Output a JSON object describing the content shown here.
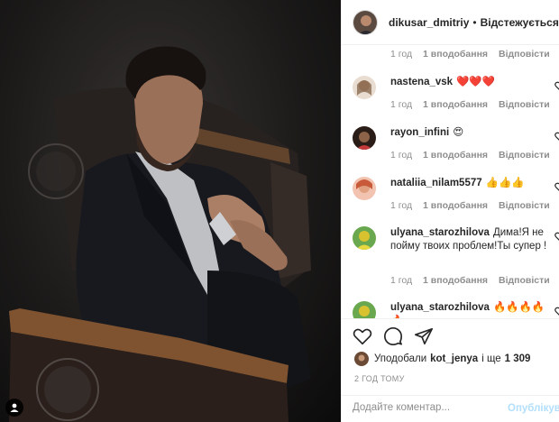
{
  "post_author": {
    "username": "dikusar_dmitriy",
    "separator": "•",
    "follow_label": "Відстежується"
  },
  "comments": [
    {
      "username": "",
      "text": "",
      "time": "1 год",
      "likes": "1 вподобання",
      "reply": "Відповісти",
      "avatar_color": "#9a7a60"
    },
    {
      "username": "nastena_vsk",
      "text": "❤️❤️❤️",
      "time": "1 год",
      "likes": "1 вподобання",
      "reply": "Відповісти",
      "avatar_color": "#c9a48a"
    },
    {
      "username": "rayon_infini",
      "text": "😍",
      "time": "1 год",
      "likes": "1 вподобання",
      "reply": "Відповісти",
      "avatar_color": "#3a2a22"
    },
    {
      "username": "nataliia_nilam5577",
      "text": "👍👍👍",
      "time": "1 год",
      "likes": "1 вподобання",
      "reply": "Відповісти",
      "avatar_color": "#d8826a"
    },
    {
      "username": "ulyana_starozhilova",
      "text": "Дима!Я не пойму твоих проблем!Ты супер !",
      "time": "1 год",
      "likes": "1 вподобання",
      "reply": "Відповісти",
      "avatar_color": "#d9c230"
    },
    {
      "username": "ulyana_starozhilova",
      "text": "🔥🔥🔥🔥🔥",
      "avatar_color": "#d9c230"
    }
  ],
  "actions": {
    "like_icon": "heart-outline-icon",
    "comment_icon": "comment-bubble-icon",
    "share_icon": "paper-plane-icon"
  },
  "likes": {
    "prefix": "Уподобали",
    "user": "kot_jenya",
    "connector": "і ще",
    "count": "1 309"
  },
  "posted_ago": "2 ГОД ТОМУ",
  "add_comment": {
    "placeholder": "Додайте коментар...",
    "publish_label": "Опублікувати"
  },
  "colors": {
    "link_disabled": "#b2dffc",
    "muted_text": "#8e8e8e",
    "border": "#efefef"
  }
}
